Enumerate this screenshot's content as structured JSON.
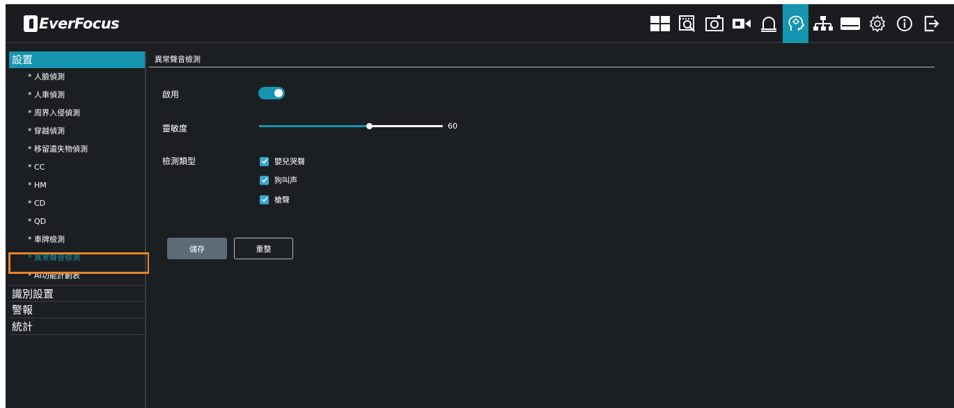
{
  "brand": {
    "name": "EverFocus"
  },
  "toolbar": {
    "icons": [
      "layout-grid-icon",
      "playback-search-icon",
      "snapshot-icon",
      "camera-icon",
      "alarm-bell-icon",
      "ai-face-icon",
      "network-icon",
      "storage-icon",
      "settings-gear-icon",
      "info-icon",
      "logout-icon"
    ],
    "active_index": 5,
    "active_color": "#1595b0"
  },
  "sidebar": {
    "settings_label": "設置",
    "items": [
      "* 人臉偵測",
      "* 人車偵測",
      "* 周界入侵偵測",
      "* 穿越偵測",
      "* 移留遺失物偵測",
      "* CC",
      "* HM",
      "* CD",
      "* QD",
      "* 車牌檢測",
      "* 異常聲音檢測",
      "* AI功能計劃表"
    ],
    "selected_index": 10,
    "groups": [
      "識別設置",
      "警報",
      "統計"
    ]
  },
  "panel": {
    "title": "異常聲音檢測",
    "enable_label": "啟用",
    "enable_value": true,
    "sensitivity_label": "靈敏度",
    "sensitivity_value": "60",
    "sensitivity_fraction": 0.6,
    "detect_type_label": "檢測類型",
    "detect_types": [
      {
        "label": "嬰兒哭聲",
        "checked": true
      },
      {
        "label": "狗叫声",
        "checked": true
      },
      {
        "label": "槍聲",
        "checked": true
      }
    ],
    "save_label": "儲存",
    "reset_label": "重整"
  },
  "colors": {
    "accent": "#1595b0",
    "selection_outline": "#e8862a",
    "background": "#1c1f22"
  }
}
